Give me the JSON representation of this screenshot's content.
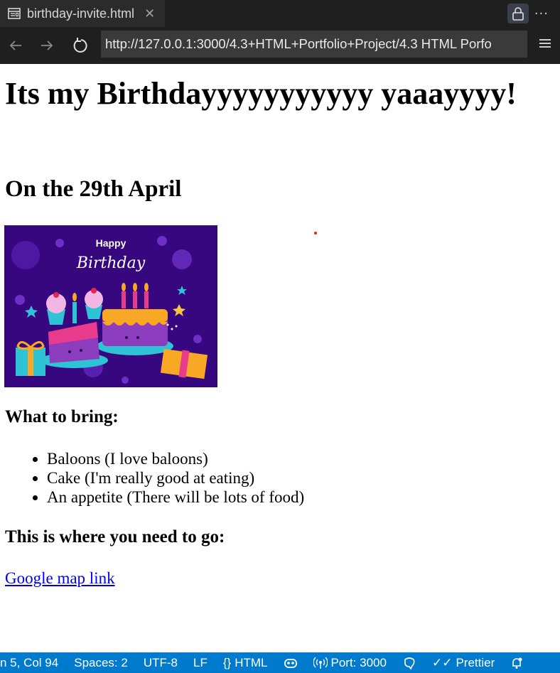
{
  "tab": {
    "title": "birthday-invite.html",
    "icons": [
      "preview-icon",
      "close-icon",
      "lock-icon",
      "more-icon"
    ]
  },
  "address": {
    "url": "http://127.0.0.1:3000/4.3+HTML+Portfolio+Project/4.3 HTML Porfo"
  },
  "page": {
    "heading": "Its my Birthdayyyyyyyyyyy yaaayyyy!",
    "date": "On the 29th April",
    "banner": {
      "line1": "Happy",
      "line2": "Birthday"
    },
    "bring_heading": "What to bring:",
    "bring_items": [
      "Baloons (I love baloons)",
      "Cake (I'm really good at eating)",
      "An appetite (There will be lots of food)"
    ],
    "go_heading": "This is where you need to go:",
    "map_link": "Google map link"
  },
  "status": {
    "position": "n 5, Col 94",
    "spaces": "Spaces: 2",
    "encoding": "UTF-8",
    "eol": "LF",
    "language": "HTML",
    "port": "Port: 3000",
    "prettier": "Prettier"
  },
  "colors": {
    "chrome_bg": "#1f1f1f",
    "status_bg": "#007acc",
    "link": "#0000ee",
    "banner_bg": "#36077f"
  }
}
